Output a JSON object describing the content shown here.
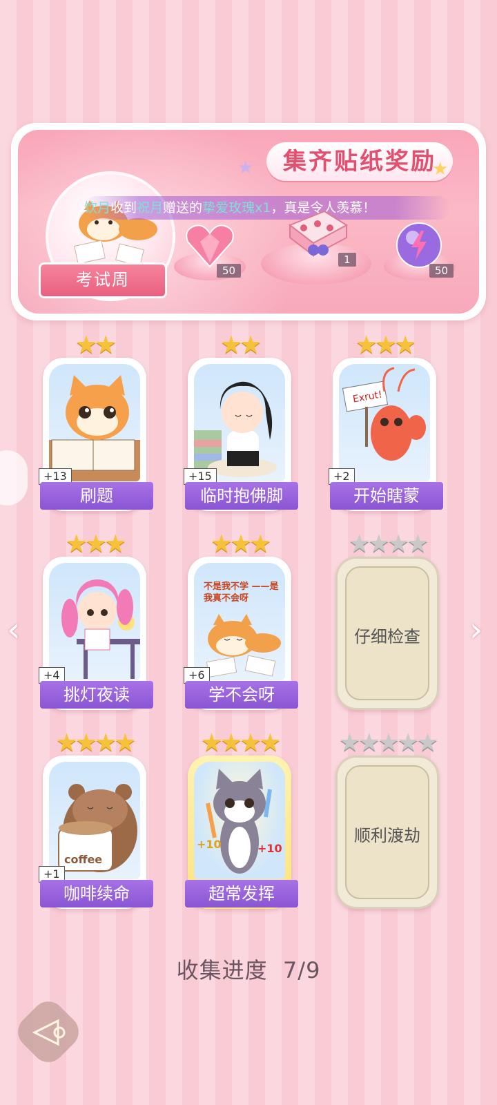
{
  "banner": {
    "title": "集齐贴纸奖励",
    "ticker_prefix_name": "饮月",
    "ticker_text1": "收到",
    "ticker_sender": "祝月",
    "ticker_text2": "赠送的",
    "ticker_gift": "挚爱玫瑰x1",
    "ticker_suffix": "，真是令人羡慕！",
    "exam_label": "考试周",
    "rewards": [
      {
        "icon": "pink-heart-gem-icon",
        "count": "50"
      },
      {
        "icon": "gift-box-icon",
        "count": "1"
      },
      {
        "icon": "lightning-orb-icon",
        "count": "50"
      }
    ]
  },
  "cards": [
    {
      "name": "刷题",
      "plus": "+13",
      "stars": 2,
      "max_stars": 2,
      "locked": false,
      "icon": "cat-studying-icon"
    },
    {
      "name": "临时抱佛脚",
      "plus": "+15",
      "stars": 2,
      "max_stars": 2,
      "locked": false,
      "icon": "girl-praying-icon"
    },
    {
      "name": "开始瞎蒙",
      "plus": "+2",
      "stars": 3,
      "max_stars": 3,
      "locked": false,
      "icon": "shrimp-sign-icon",
      "sign": "Exrut!"
    },
    {
      "name": "挑灯夜读",
      "plus": "+4",
      "stars": 3,
      "max_stars": 3,
      "locked": false,
      "icon": "girl-desk-lamp-icon"
    },
    {
      "name": "学不会呀",
      "plus": "+6",
      "stars": 3,
      "max_stars": 3,
      "locked": false,
      "icon": "shiba-lying-icon",
      "caption": "不是我不学 ——是我真不会呀"
    },
    {
      "name": "仔细检查",
      "plus": "",
      "stars": 0,
      "max_stars": 4,
      "locked": true,
      "icon": ""
    },
    {
      "name": "咖啡续命",
      "plus": "+1",
      "stars": 4,
      "max_stars": 4,
      "locked": false,
      "icon": "bear-coffee-icon",
      "cup_text": "coffee"
    },
    {
      "name": "超常发挥",
      "plus": "",
      "stars": 4,
      "max_stars": 4,
      "locked": false,
      "gold": true,
      "icon": "cat-pencils-icon",
      "bonus": "+10"
    },
    {
      "name": "顺利渡劫",
      "plus": "",
      "stars": 0,
      "max_stars": 5,
      "locked": true,
      "icon": ""
    }
  ],
  "progress": {
    "label": "收集进度",
    "value": "7/9"
  },
  "colors": {
    "accent": "#8a55d2",
    "title": "#e3506f",
    "star": "#f6c23b"
  }
}
